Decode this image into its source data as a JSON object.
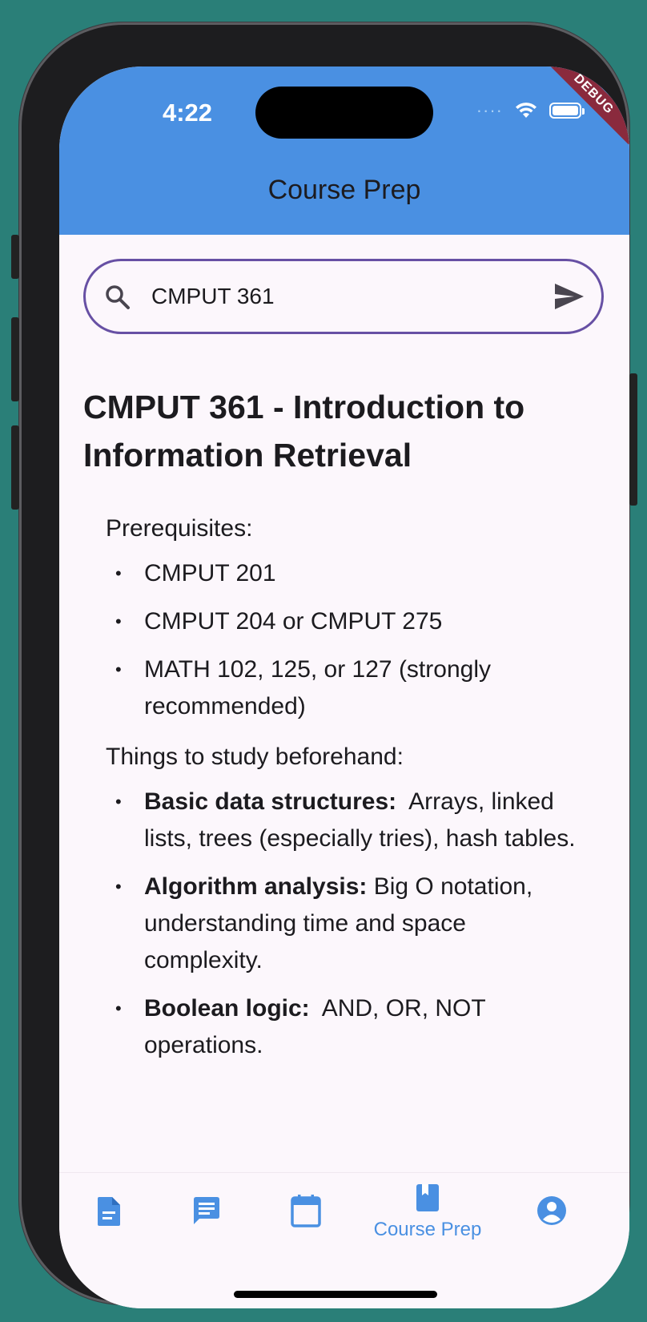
{
  "status_bar": {
    "time": "4:22",
    "signal": "····",
    "debug_banner": "DEBUG"
  },
  "app_bar": {
    "title": "Course Prep"
  },
  "search": {
    "value": "CMPUT 361"
  },
  "course": {
    "title": "CMPUT 361 - Introduction to Information Retrieval",
    "prereq_heading": "Prerequisites:",
    "prerequisites": [
      "CMPUT 201",
      "CMPUT 204 or CMPUT 275",
      "MATH 102, 125, or 127 (strongly recommended)"
    ],
    "study_heading": "Things to study beforehand:",
    "study_items": [
      {
        "term": "Basic data structures:",
        "desc": "  Arrays, linked lists, trees (especially tries), hash tables."
      },
      {
        "term": "Algorithm analysis:",
        "desc": " Big O notation, understanding time and space complexity."
      },
      {
        "term": "Boolean logic:",
        "desc": "  AND, OR, NOT operations."
      }
    ]
  },
  "bottom_nav": {
    "active_label": "Course Prep",
    "icons": [
      "document-icon",
      "chat-icon",
      "calendar-icon",
      "book-icon",
      "account-icon"
    ]
  },
  "colors": {
    "app_bar": "#4a90e2",
    "accent": "#4a90e2",
    "search_border": "#6750a4",
    "background": "#fcf7fc",
    "frame_background": "#2a7f78"
  }
}
